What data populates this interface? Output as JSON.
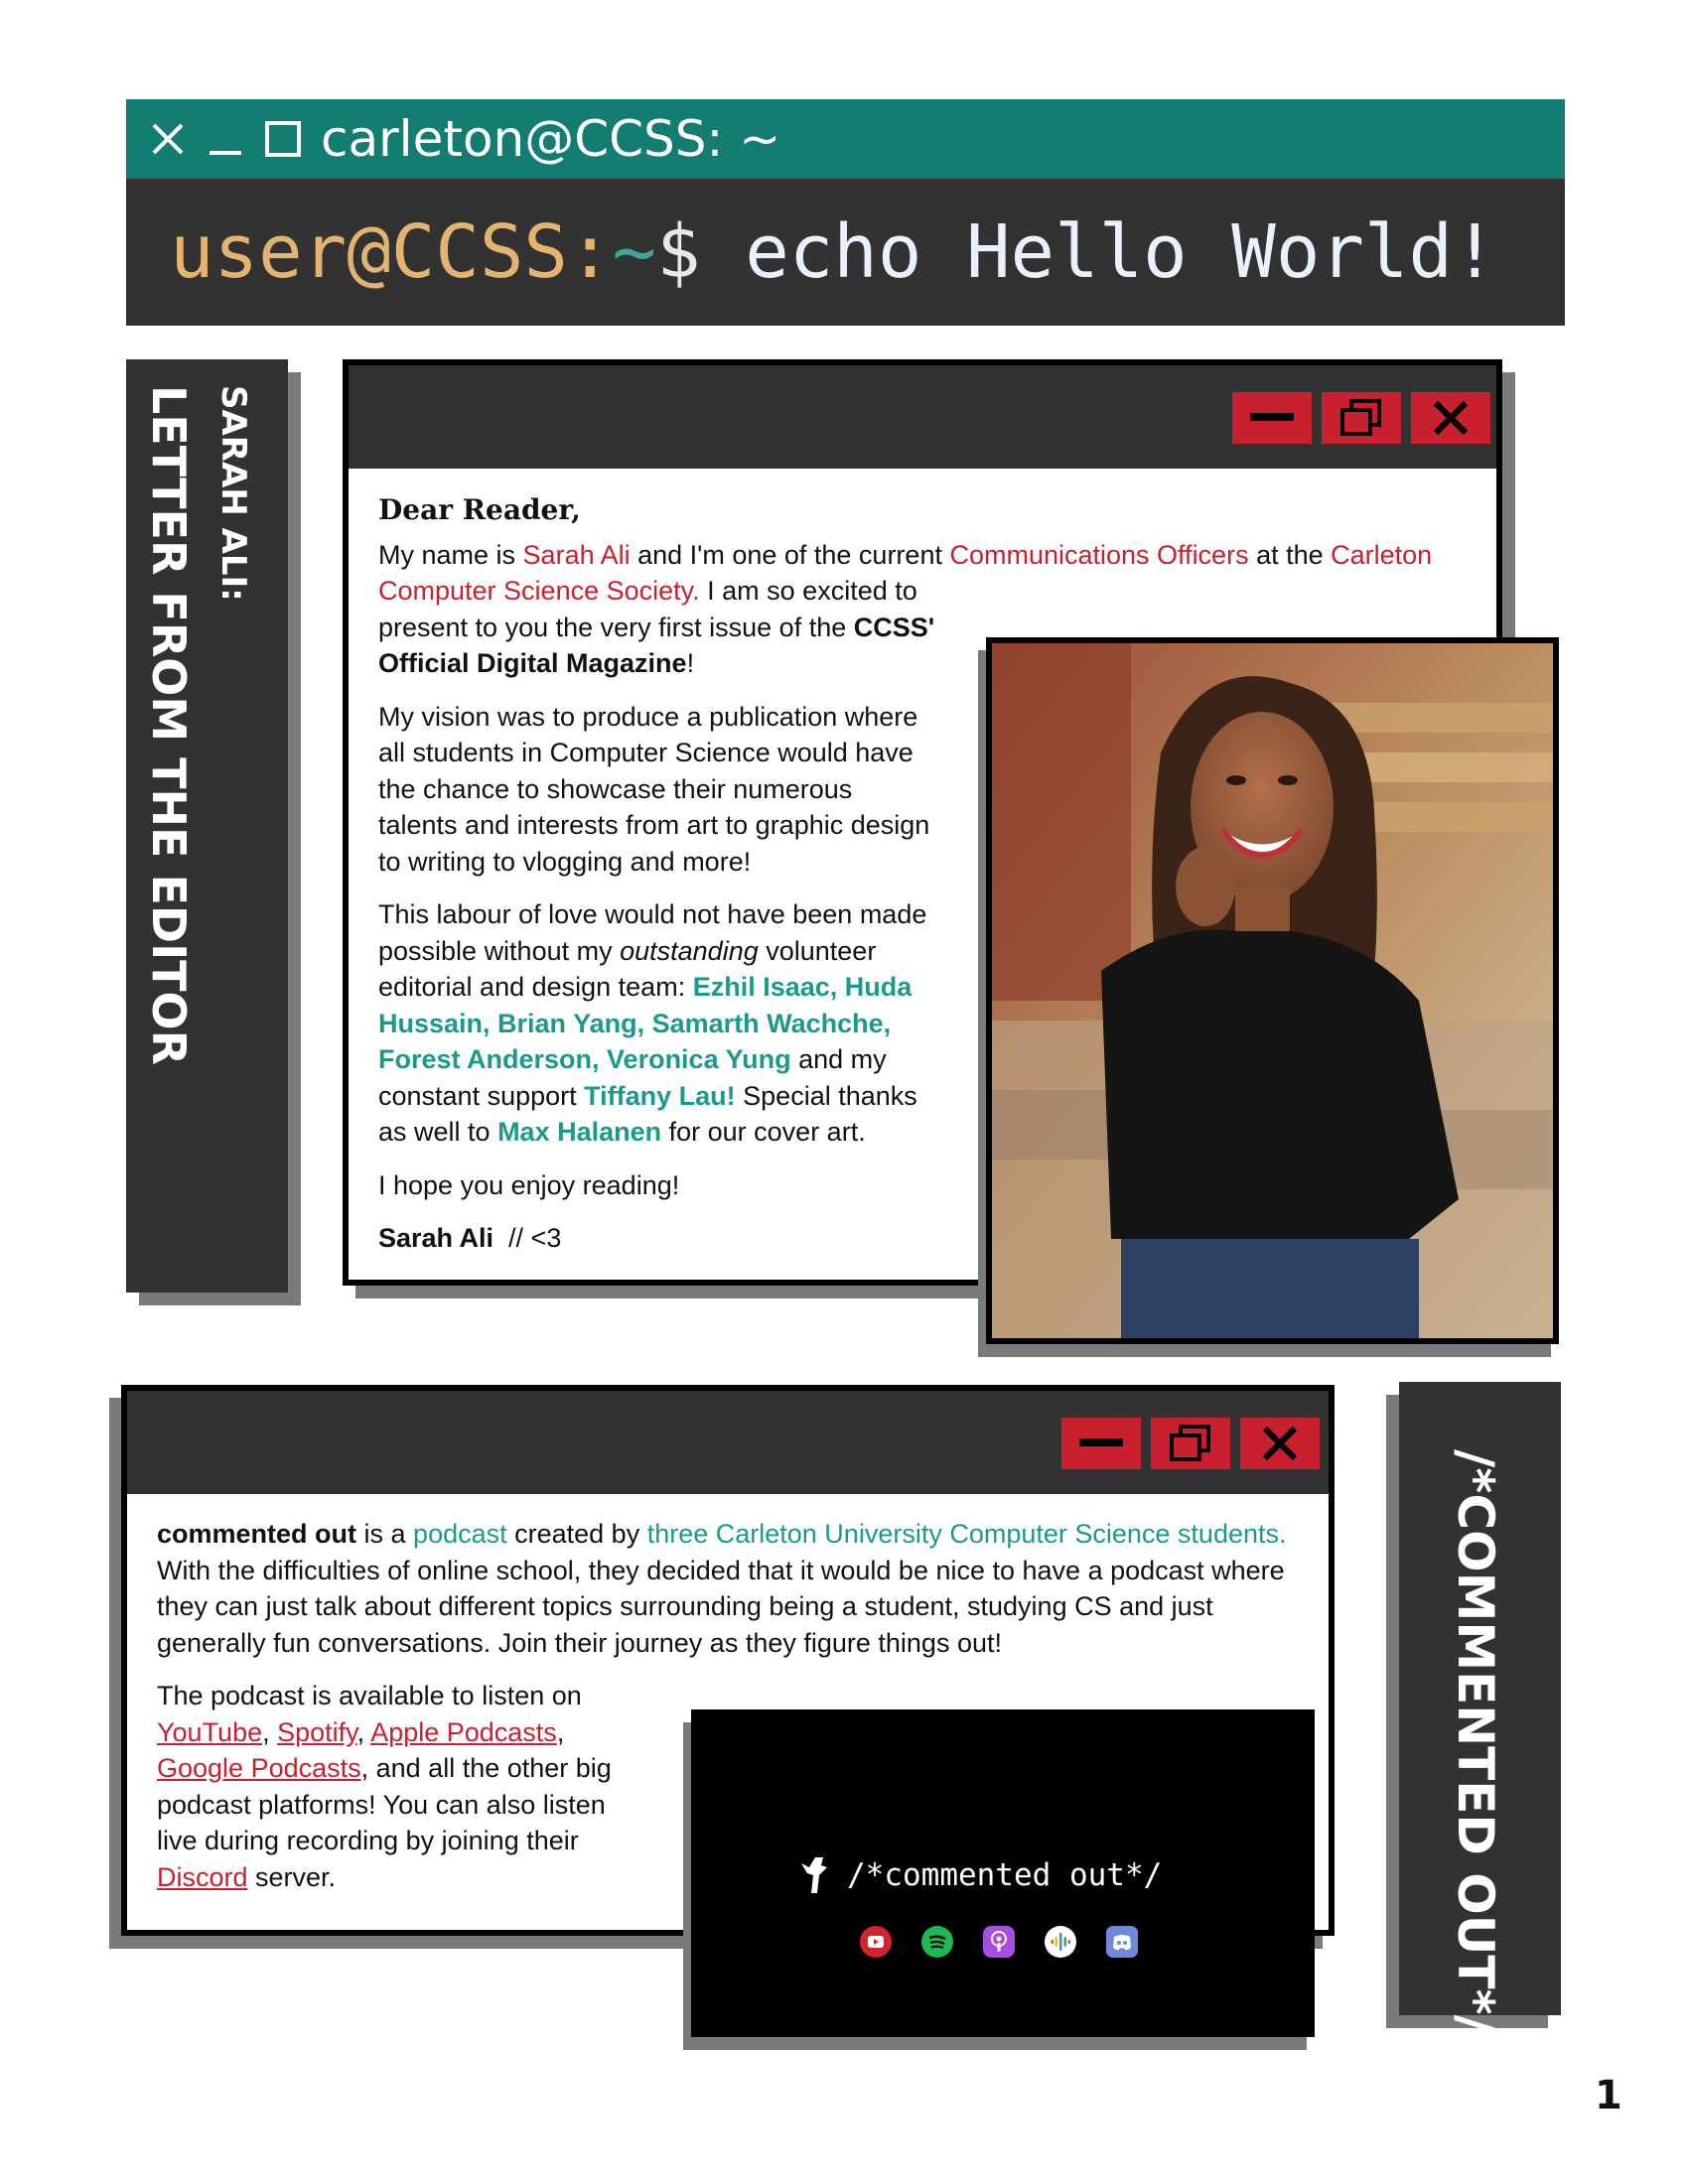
{
  "terminal": {
    "window_title": "carleton@CCSS: ~",
    "prompt_user": "user@CCSS:",
    "prompt_tilde": "~",
    "prompt_dollar": "$",
    "command": " echo Hello World!",
    "controls": [
      "close-icon",
      "minimize-icon",
      "maximize-icon"
    ],
    "accent": "#137d72"
  },
  "editor_sidebar": {
    "author": "SARAH ALI:",
    "section": "LETTER FROM THE EDITOR"
  },
  "letter": {
    "greeting": "Dear Reader,",
    "p1": {
      "t1": "My name is ",
      "name": "Sarah Ali",
      "t2": " and I'm one of the current ",
      "role": "Communications Officers",
      "t3": " at the ",
      "society_a": "Carleton",
      "society_b": "Computer Science Society.",
      "t4a": " I am so excited to",
      "t4b": "present to you the very first issue of the ",
      "mag_a": "CCSS'",
      "mag_b": "Official Digital Magazine",
      "t5": "!"
    },
    "p2": [
      "My vision was to produce a publication where",
      "all students in Computer Science would have",
      "the chance to showcase their numerous",
      "talents and interests from art to graphic design",
      "to writing to vlogging and more!"
    ],
    "p3": {
      "l1": "This labour of love would not have been made",
      "l2a": "possible without my ",
      "l2em": "outstanding",
      "l2b": " volunteer",
      "l3a": "editorial and design team: ",
      "l3team": "Ezhil Isaac, Huda",
      "l4team": "Hussain, Brian Yang, Samarth Wachche,",
      "l5team": "Forest Anderson, Veronica Yung",
      "l5b": " and my",
      "l6a": "constant support ",
      "l6name": "Tiffany Lau!",
      "l6b": " Special thanks",
      "l7a": "as well to ",
      "l7name": "Max Halanen",
      "l7b": " for our cover art."
    },
    "p4": "I hope you enjoy reading!",
    "signature_name": "Sarah Ali",
    "signature_tail": "  // <3"
  },
  "photo": {
    "description_icon": "portrait-photo"
  },
  "podcast": {
    "sidebar_label": "/*COMMENTED OUT*/",
    "intro": {
      "bold": "commented out",
      "t1": " is a ",
      "podcast": "podcast",
      "t2": " created by ",
      "creators": "three Carleton University Computer Science students.",
      "l2": "With the difficulties of online school, they decided that it would be nice to have a podcast where",
      "l3": "they can just talk about different topics surrounding being a student, studying CS and just",
      "l4": "generally fun conversations. Join their journey as they figure things out!"
    },
    "avail": {
      "l1": "The podcast is available to listen on",
      "youtube": "YouTube",
      "spotify": "Spotify",
      "apple": "Apple Podcasts",
      "google": "Google Podcasts",
      "l3b": ", and all the other big",
      "l4": "podcast platforms! You can also listen",
      "l5": "live during recording by joining their",
      "discord": "Discord",
      "l6b": " server."
    },
    "card": {
      "logo_text": "/*commented out*/",
      "icons": [
        "youtube-icon",
        "spotify-icon",
        "apple-podcasts-icon",
        "google-podcasts-icon",
        "discord-icon"
      ]
    }
  },
  "page_number": "1",
  "colors": {
    "red": "#c8202f",
    "teal": "#1a9a8b",
    "dark": "#323232"
  }
}
